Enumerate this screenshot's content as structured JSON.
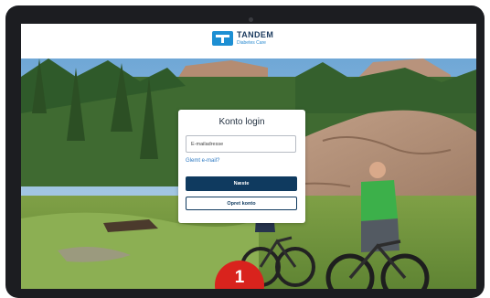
{
  "header": {
    "brand_name": "TANDEM",
    "brand_sub": "Diabetes Care"
  },
  "login": {
    "title": "Konto login",
    "email_placeholder": "E-mailadresse",
    "forgot_link": "Glemt e-mail?",
    "next_button": "Næste",
    "create_button": "Opret konto"
  },
  "step_badge": {
    "number": "1"
  },
  "colors": {
    "brand_blue": "#1d8fd3",
    "primary_navy": "#0f3a5f",
    "link_blue": "#2d79c2",
    "badge_red": "#d9231d"
  },
  "icons": {
    "logo": "tandem-logo-icon"
  }
}
